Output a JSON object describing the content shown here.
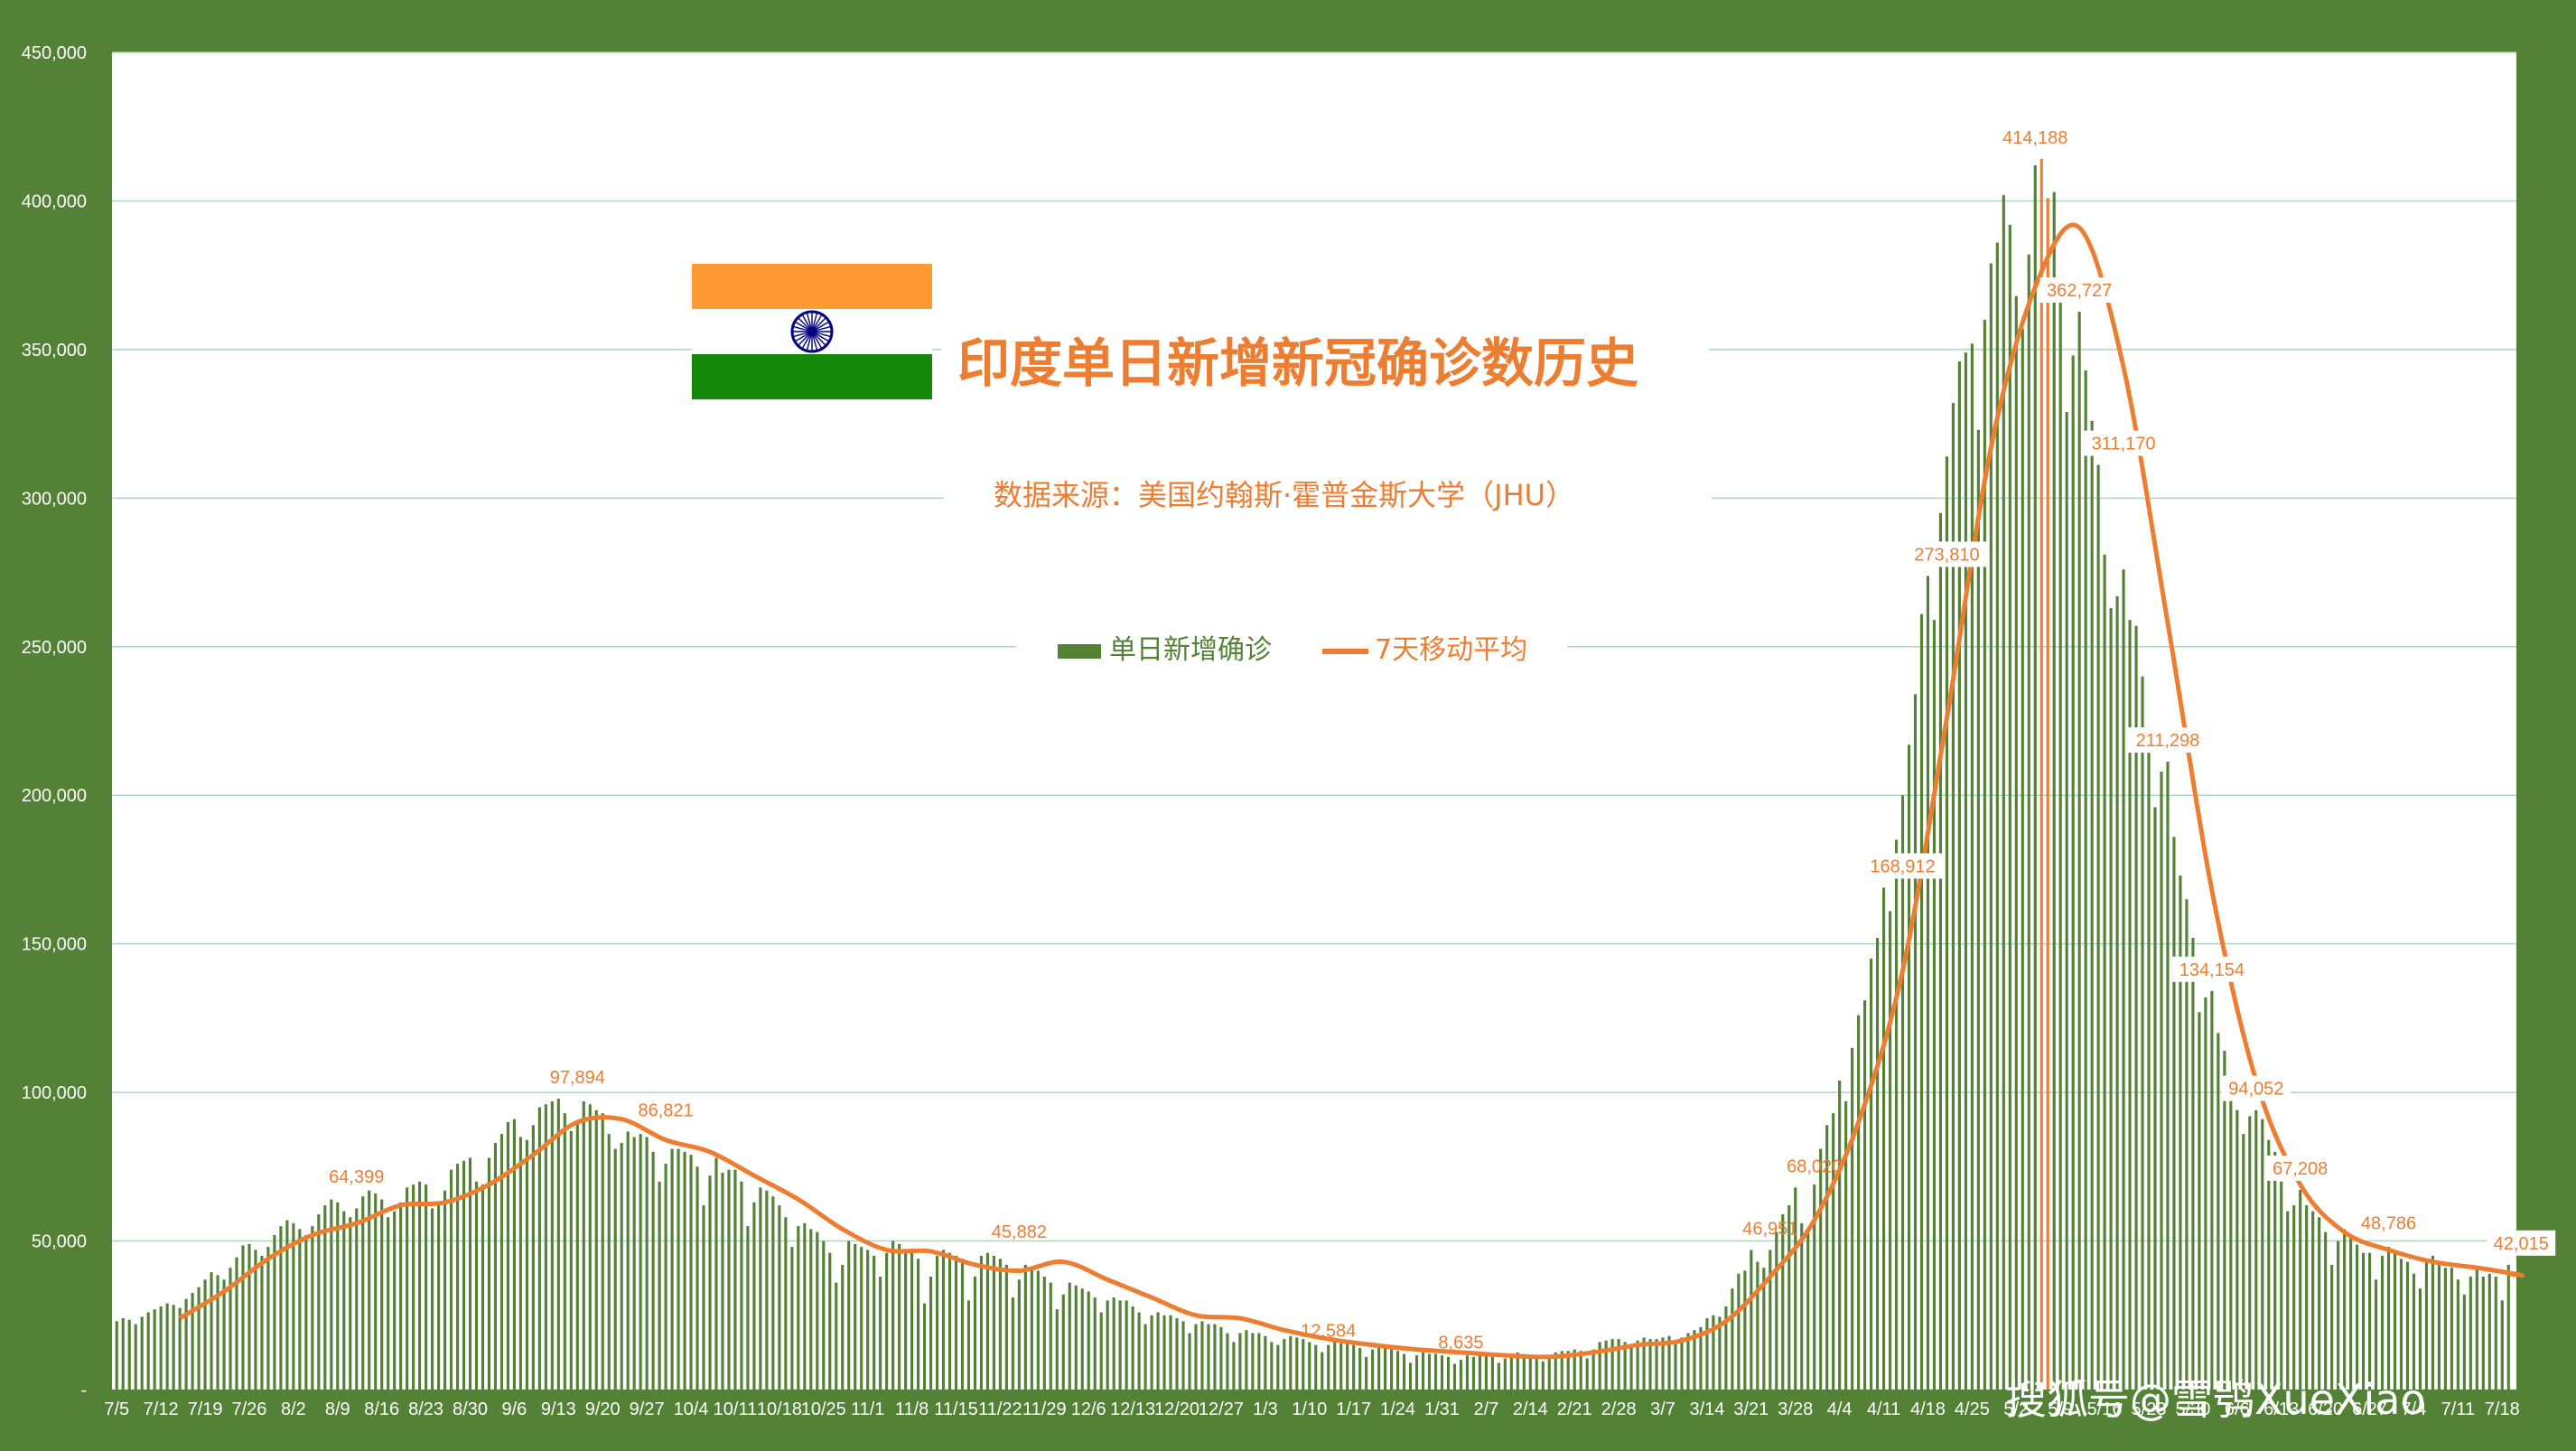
{
  "title": "印度单日新增新冠确诊数历史",
  "subtitle": "数据来源：美国约翰斯·霍普金斯大学（JHU）",
  "watermark": "搜狐号@雪鸮XueXiao",
  "legend": {
    "bar_label": "单日新增确诊",
    "line_label": "7天移动平均",
    "position": "top-center"
  },
  "colors": {
    "background": "#538135",
    "plot": "#ffffff",
    "bar": "#538135",
    "bar_highlight": "#ED7D31",
    "line": "#ED7D31",
    "grid": "#A9D9B8",
    "flag_saffron": "#FF9933",
    "flag_green": "#138808",
    "flag_chakra": "#000080"
  },
  "chart_data": {
    "type": "bar",
    "grid": true,
    "ylim": [
      0,
      450000
    ],
    "y_ticks": [
      "-",
      "50,000",
      "100,000",
      "150,000",
      "200,000",
      "250,000",
      "300,000",
      "350,000",
      "400,000",
      "450,000"
    ],
    "x_tick_labels": [
      "7/5",
      "7/12",
      "7/19",
      "7/26",
      "8/2",
      "8/9",
      "8/16",
      "8/23",
      "8/30",
      "9/6",
      "9/13",
      "9/20",
      "9/27",
      "10/4",
      "10/11",
      "10/18",
      "10/25",
      "11/1",
      "11/8",
      "11/15",
      "11/22",
      "11/29",
      "12/6",
      "12/13",
      "12/20",
      "12/27",
      "1/3",
      "1/10",
      "1/17",
      "1/24",
      "1/31",
      "2/7",
      "2/14",
      "2/21",
      "2/28",
      "3/7",
      "3/14",
      "3/21",
      "3/28",
      "4/4",
      "4/11",
      "4/18",
      "4/25",
      "5/2",
      "5/9",
      "5/16",
      "5/23",
      "5/30",
      "6/6",
      "6/13",
      "6/20",
      "6/27",
      "7/4",
      "7/11",
      "7/18"
    ],
    "weekly_bars": [
      {
        "week": "7/5",
        "values": [
          23000,
          24000,
          23500,
          22000,
          24500,
          26000,
          27000
        ]
      },
      {
        "week": "7/12",
        "values": [
          28000,
          29000,
          28500,
          27500,
          30500,
          32500,
          34500
        ]
      },
      {
        "week": "7/19",
        "values": [
          37000,
          39500,
          38500,
          37000,
          41000,
          44500,
          48500
        ]
      },
      {
        "week": "7/26",
        "values": [
          49000,
          47000,
          45000,
          48000,
          52000,
          55000,
          57000
        ]
      },
      {
        "week": "8/2",
        "values": [
          56000,
          54000,
          52000,
          55000,
          59000,
          62000,
          64000
        ]
      },
      {
        "week": "8/9",
        "values": [
          63000,
          60000,
          58000,
          61000,
          65000,
          67000,
          66000
        ]
      },
      {
        "week": "8/16",
        "values": [
          64000,
          58000,
          60000,
          63000,
          68000,
          69000,
          70000
        ]
      },
      {
        "week": "8/23",
        "values": [
          69000,
          61000,
          62000,
          67000,
          74000,
          76000,
          77000
        ]
      },
      {
        "week": "8/30",
        "values": [
          78000,
          70000,
          69000,
          78000,
          83000,
          86000,
          90000
        ]
      },
      {
        "week": "9/6",
        "values": [
          91000,
          85000,
          84000,
          89000,
          95000,
          96000,
          97000
        ]
      },
      {
        "week": "9/13",
        "values": [
          97894,
          93000,
          87000,
          90000,
          97000,
          96000,
          94000
        ]
      },
      {
        "week": "9/20",
        "values": [
          93000,
          86000,
          81000,
          83000,
          86821,
          85000,
          86000
        ]
      },
      {
        "week": "9/27",
        "values": [
          85000,
          80000,
          70000,
          76000,
          81000,
          81000,
          80000
        ]
      },
      {
        "week": "10/4",
        "values": [
          79000,
          75000,
          62000,
          72000,
          78000,
          73000,
          74000
        ]
      },
      {
        "week": "10/11",
        "values": [
          74000,
          70000,
          55000,
          63000,
          68000,
          67000,
          65000
        ]
      },
      {
        "week": "10/18",
        "values": [
          62000,
          58000,
          48000,
          55000,
          56000,
          54000,
          53000
        ]
      },
      {
        "week": "10/25",
        "values": [
          50000,
          46000,
          36000,
          42000,
          50000,
          49000,
          48000
        ]
      },
      {
        "week": "11/1",
        "values": [
          47000,
          45000,
          38000,
          46000,
          50000,
          49000,
          47000
        ]
      },
      {
        "week": "11/8",
        "values": [
          45882,
          44000,
          29000,
          38000,
          45000,
          47000,
          46000
        ]
      },
      {
        "week": "11/15",
        "values": [
          45000,
          44000,
          30000,
          38000,
          45000,
          46000,
          45000
        ]
      },
      {
        "week": "11/22",
        "values": [
          44000,
          42000,
          31000,
          37000,
          42000,
          41000,
          40000
        ]
      },
      {
        "week": "11/29",
        "values": [
          38000,
          36000,
          27000,
          32000,
          36000,
          35000,
          34000
        ]
      },
      {
        "week": "12/6",
        "values": [
          33000,
          31000,
          26000,
          30000,
          31000,
          30000,
          30000
        ]
      },
      {
        "week": "12/13",
        "values": [
          28000,
          26000,
          22000,
          25000,
          26000,
          25000,
          25000
        ]
      },
      {
        "week": "12/20",
        "values": [
          24000,
          23000,
          19000,
          22000,
          23000,
          22000,
          22000
        ]
      },
      {
        "week": "12/27",
        "values": [
          21000,
          19000,
          16000,
          19000,
          20000,
          19000,
          19000
        ]
      },
      {
        "week": "1/3",
        "values": [
          18000,
          16000,
          15000,
          17000,
          18000,
          17500,
          17000
        ]
      },
      {
        "week": "1/10",
        "values": [
          16000,
          15000,
          12584,
          15000,
          16000,
          15500,
          15500
        ]
      },
      {
        "week": "1/17",
        "values": [
          15000,
          14000,
          11000,
          13500,
          15000,
          14500,
          14000
        ]
      },
      {
        "week": "1/24",
        "values": [
          13000,
          12000,
          9000,
          11500,
          12500,
          12000,
          12000
        ]
      },
      {
        "week": "1/31",
        "values": [
          11500,
          11000,
          8635,
          10000,
          11500,
          11000,
          11500
        ]
      },
      {
        "week": "2/7",
        "values": [
          12000,
          11000,
          9000,
          10500,
          12000,
          12500,
          12000
        ]
      },
      {
        "week": "2/14",
        "values": [
          11500,
          11000,
          9500,
          11500,
          12500,
          13000,
          13000
        ]
      },
      {
        "week": "2/21",
        "values": [
          13500,
          13000,
          10500,
          13500,
          16000,
          16500,
          17000
        ]
      },
      {
        "week": "2/28",
        "values": [
          17000,
          16000,
          14000,
          16500,
          17500,
          17000,
          17000
        ]
      },
      {
        "week": "3/7",
        "values": [
          17500,
          18000,
          15500,
          17500,
          19000,
          20000,
          21000
        ]
      },
      {
        "week": "3/14",
        "values": [
          24000,
          25000,
          24500,
          28000,
          34000,
          39000,
          40000
        ]
      },
      {
        "week": "3/21",
        "values": [
          46951,
          43000,
          41000,
          47000,
          53000,
          59000,
          62000
        ]
      },
      {
        "week": "3/28",
        "values": [
          68020,
          56000,
          53000,
          69000,
          81000,
          89000,
          93000
        ]
      },
      {
        "week": "4/4",
        "values": [
          104000,
          97000,
          115000,
          126000,
          131000,
          145000,
          152000
        ]
      },
      {
        "week": "4/11",
        "values": [
          168912,
          161000,
          185000,
          200000,
          217000,
          234000,
          261000
        ]
      },
      {
        "week": "4/18",
        "values": [
          273810,
          259000,
          295000,
          314000,
          332000,
          346000,
          349000
        ]
      },
      {
        "week": "4/25",
        "values": [
          352000,
          323000,
          360000,
          379000,
          386000,
          402000,
          392000
        ]
      },
      {
        "week": "5/2",
        "values": [
          368000,
          357000,
          382000,
          412000,
          414188,
          401000,
          403000
        ]
      },
      {
        "week": "5/9",
        "values": [
          366000,
          329000,
          348000,
          362727,
          343000,
          326000,
          311170
        ]
      },
      {
        "week": "5/16",
        "values": [
          281000,
          263000,
          267000,
          276000,
          259000,
          257000,
          240000
        ]
      },
      {
        "week": "5/23",
        "values": [
          222000,
          196000,
          208000,
          211298,
          186000,
          173000,
          165000
        ]
      },
      {
        "week": "5/30",
        "values": [
          152000,
          127000,
          132000,
          134154,
          120000,
          114000,
          100000
        ]
      },
      {
        "week": "6/6",
        "values": [
          94052,
          86000,
          92000,
          94000,
          91000,
          84000,
          80000
        ]
      },
      {
        "week": "6/13",
        "values": [
          70000,
          60000,
          62000,
          67208,
          62000,
          60000,
          58000
        ]
      },
      {
        "week": "6/20",
        "values": [
          53000,
          42000,
          50000,
          54000,
          51000,
          48786,
          46000
        ]
      },
      {
        "week": "6/27",
        "values": [
          46000,
          37000,
          45000,
          48000,
          46000,
          44000,
          43000
        ]
      },
      {
        "week": "7/4",
        "values": [
          39000,
          34000,
          43000,
          45000,
          43000,
          41000,
          41000
        ]
      },
      {
        "week": "7/11",
        "values": [
          37000,
          32000,
          38000,
          41000,
          38000,
          39000,
          38000
        ]
      },
      {
        "week": "7/18",
        "values": [
          30000,
          42015
        ]
      }
    ],
    "moving_average": {
      "name": "7天移动平均",
      "points": [
        [
          "7/12",
          24000
        ],
        [
          "7/19",
          33000
        ],
        [
          "7/26",
          44000
        ],
        [
          "8/2",
          52000
        ],
        [
          "8/9",
          56000
        ],
        [
          "8/16",
          62000
        ],
        [
          "8/23",
          63000
        ],
        [
          "8/30",
          69000
        ],
        [
          "9/6",
          79000
        ],
        [
          "9/13",
          90000
        ],
        [
          "9/20",
          91000
        ],
        [
          "9/27",
          84000
        ],
        [
          "10/4",
          80000
        ],
        [
          "10/11",
          72000
        ],
        [
          "10/18",
          64000
        ],
        [
          "10/25",
          54000
        ],
        [
          "11/1",
          47000
        ],
        [
          "11/8",
          46500
        ],
        [
          "11/15",
          42000
        ],
        [
          "11/22",
          40000
        ],
        [
          "11/29",
          43000
        ],
        [
          "12/6",
          37000
        ],
        [
          "12/13",
          31000
        ],
        [
          "12/20",
          25000
        ],
        [
          "12/27",
          24000
        ],
        [
          "1/3",
          20000
        ],
        [
          "1/10",
          17000
        ],
        [
          "1/17",
          15000
        ],
        [
          "1/24",
          13500
        ],
        [
          "1/31",
          12500
        ],
        [
          "2/7",
          11500
        ],
        [
          "2/14",
          11000
        ],
        [
          "2/21",
          12500
        ],
        [
          "2/28",
          15000
        ],
        [
          "3/7",
          16500
        ],
        [
          "3/14",
          23000
        ],
        [
          "3/21",
          38000
        ],
        [
          "3/28",
          57000
        ],
        [
          "4/4",
          90000
        ],
        [
          "4/11",
          141000
        ],
        [
          "4/18",
          226000
        ],
        [
          "4/25",
          317000
        ],
        [
          "5/2",
          371000
        ],
        [
          "5/9",
          391000
        ],
        [
          "5/16",
          344000
        ],
        [
          "5/23",
          258000
        ],
        [
          "5/30",
          168000
        ],
        [
          "6/6",
          104000
        ],
        [
          "6/13",
          69000
        ],
        [
          "6/20",
          53000
        ],
        [
          "6/27",
          47000
        ],
        [
          "7/4",
          43000
        ],
        [
          "7/11",
          41000
        ],
        [
          "7/18",
          38500
        ],
        [
          "7/20",
          39000
        ]
      ]
    },
    "data_labels": [
      {
        "x": "8/9",
        "value": 64399,
        "text": "64,399",
        "boxed": false
      },
      {
        "x": "9/13",
        "value": 97894,
        "text": "97,894",
        "boxed": false
      },
      {
        "x": "9/27",
        "value": 86821,
        "text": "86,821",
        "boxed": false
      },
      {
        "x": "11/22",
        "value": 45882,
        "text": "45,882",
        "boxed": false
      },
      {
        "x": "1/10",
        "value": 12584,
        "text": "12,584",
        "boxed": false
      },
      {
        "x": "1/31",
        "value": 8635,
        "text": "8,635",
        "boxed": false
      },
      {
        "x": "3/21",
        "value": 46951,
        "text": "46,951",
        "boxed": false
      },
      {
        "x": "3/28",
        "value": 68020,
        "text": "68,020",
        "boxed": false
      },
      {
        "x": "4/11",
        "value": 168912,
        "text": "168,912",
        "boxed": true
      },
      {
        "x": "4/18",
        "value": 273810,
        "text": "273,810",
        "boxed": true
      },
      {
        "x": "5/2",
        "value": 414188,
        "text": "414,188",
        "boxed": false
      },
      {
        "x": "5/9",
        "value": 362727,
        "text": "362,727",
        "boxed": true
      },
      {
        "x": "5/16",
        "value": 311170,
        "text": "311,170",
        "boxed": true
      },
      {
        "x": "5/23",
        "value": 211298,
        "text": "211,298",
        "boxed": true
      },
      {
        "x": "5/30",
        "value": 134154,
        "text": "134,154",
        "boxed": true
      },
      {
        "x": "6/6",
        "value": 94052,
        "text": "94,052",
        "boxed": true
      },
      {
        "x": "6/13",
        "value": 67208,
        "text": "67,208",
        "boxed": true
      },
      {
        "x": "6/27",
        "value": 48786,
        "text": "48,786",
        "boxed": true
      },
      {
        "x": "7/18",
        "value": 42015,
        "text": "42,015",
        "boxed": true
      }
    ]
  }
}
